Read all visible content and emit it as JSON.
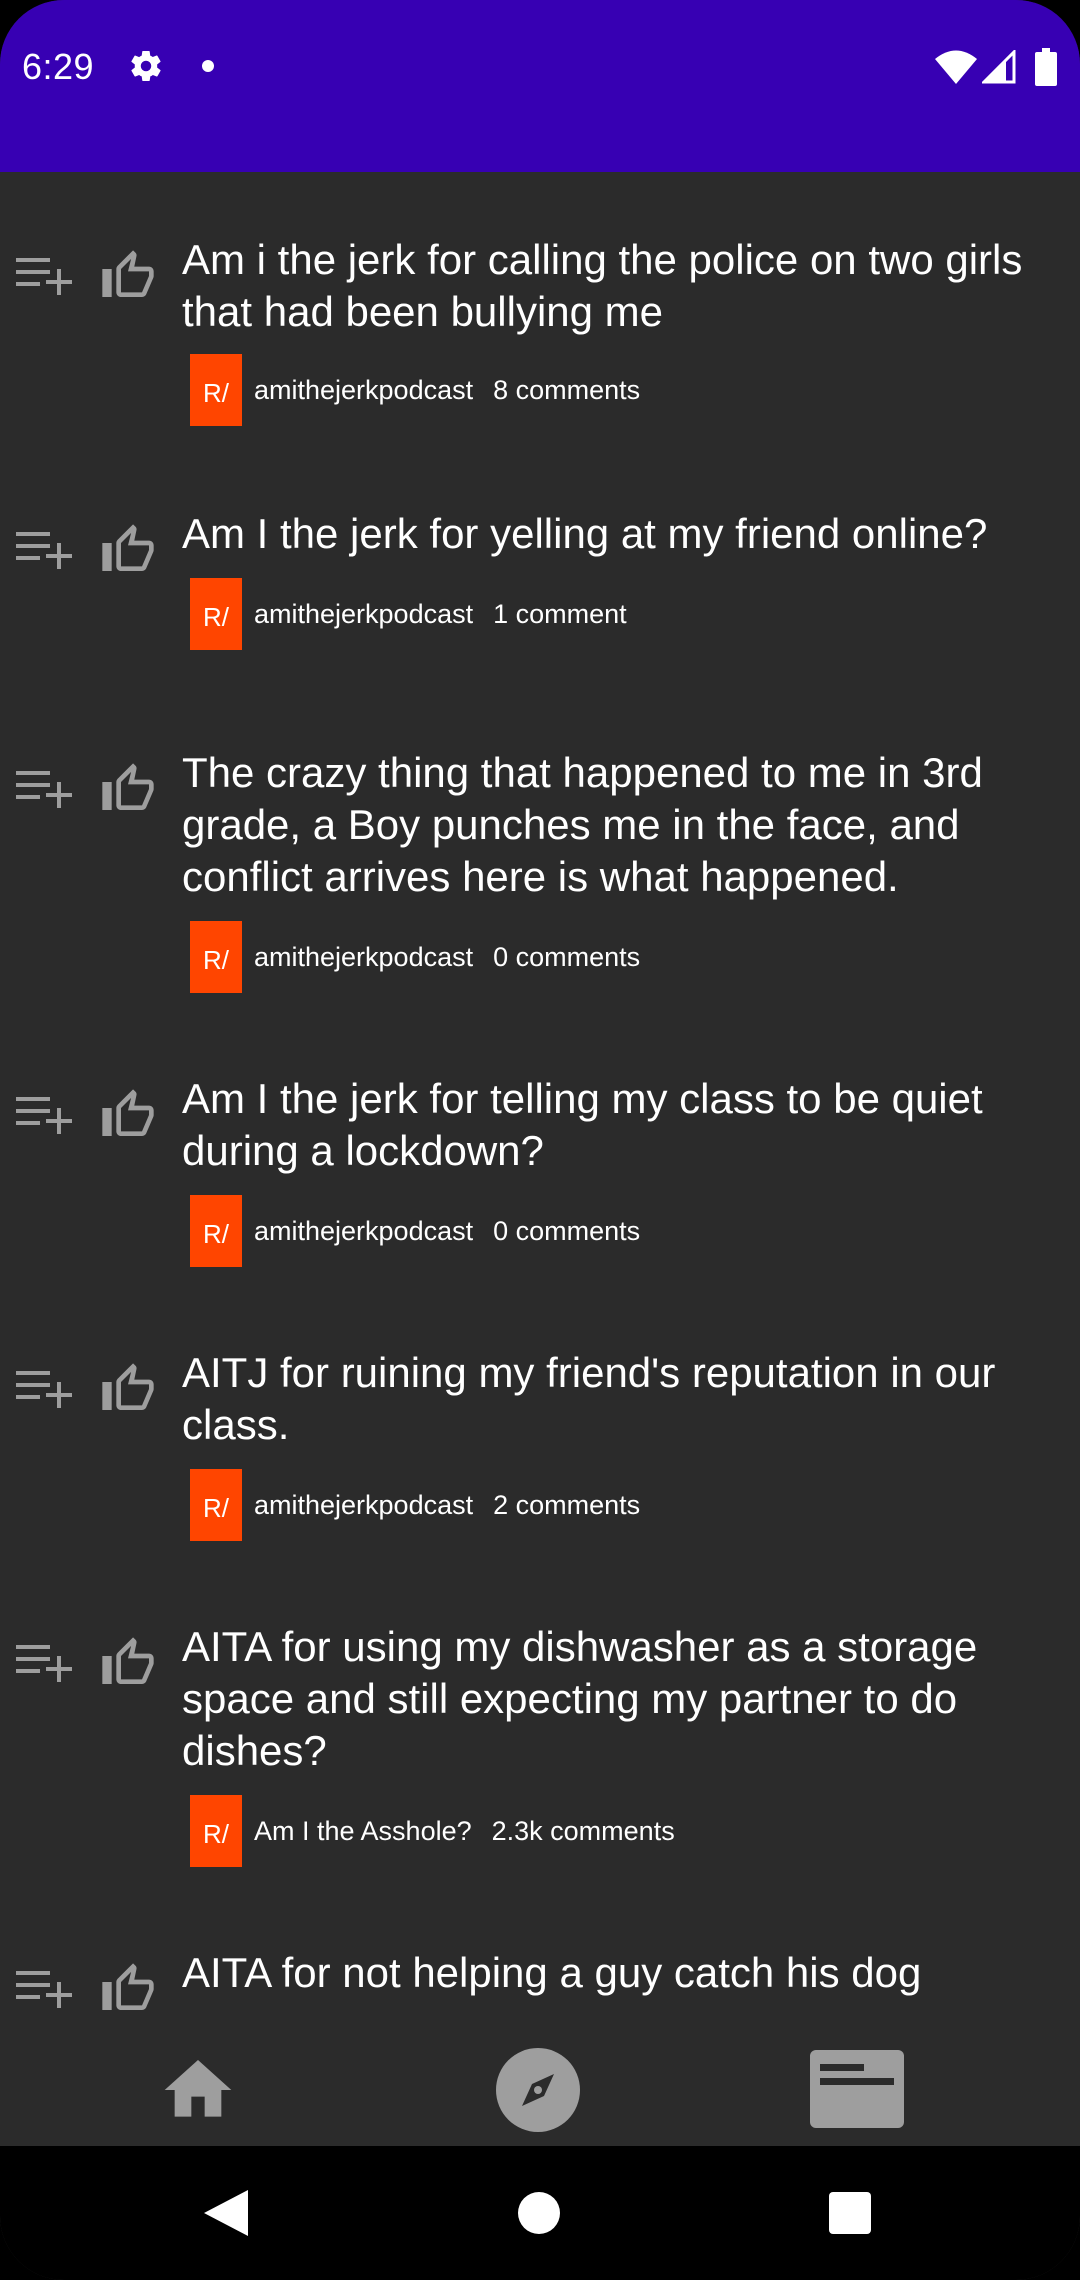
{
  "status_bar": {
    "time": "6:29",
    "icons": [
      "gear-icon",
      "notification-dot-icon",
      "wifi-icon",
      "signal-icon",
      "battery-icon"
    ]
  },
  "colors": {
    "app_bar": "#3700b3",
    "background": "#2b2b2b",
    "subreddit_badge": "#ff4500",
    "icon_gray": "#9e9e9e"
  },
  "posts": [
    {
      "title": "Am i the jerk for calling the police on two girls that had been bullying me",
      "badge": "R/",
      "subreddit": "amithejerkpodcast",
      "comments": "8 comments"
    },
    {
      "title": "Am I the jerk for yelling at my friend online?",
      "badge": "R/",
      "subreddit": "amithejerkpodcast",
      "comments": "1 comment"
    },
    {
      "title": "The crazy thing that happened to me in 3rd grade, a Boy punches me in the face, and conflict arrives here is what happened.",
      "badge": "R/",
      "subreddit": "amithejerkpodcast",
      "comments": "0 comments"
    },
    {
      "title": "Am I the jerk for telling my class to be quiet during a lockdown?",
      "badge": "R/",
      "subreddit": "amithejerkpodcast",
      "comments": "0 comments"
    },
    {
      "title": "AITJ for ruining my friend's reputation in our class.",
      "badge": "R/",
      "subreddit": "amithejerkpodcast",
      "comments": "2 comments"
    },
    {
      "title": "AITA for using my dishwasher as a storage space and still expecting my partner to do dishes?",
      "badge": "R/",
      "subreddit": "Am I the Asshole?",
      "comments": "2.3k comments"
    },
    {
      "title": "AITA for not helping a guy catch his dog",
      "badge": "",
      "subreddit": "",
      "comments": ""
    }
  ],
  "bottom_nav": {
    "items": [
      "home-icon",
      "explore-compass-icon",
      "feed-card-icon"
    ]
  },
  "system_nav": {
    "items": [
      "back-icon",
      "home-circle-icon",
      "recents-square-icon"
    ]
  }
}
